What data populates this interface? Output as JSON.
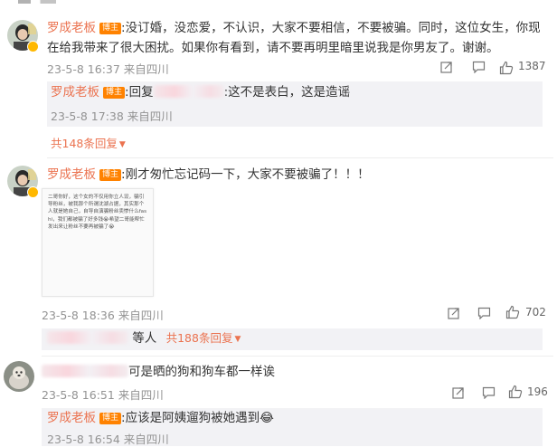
{
  "comments": [
    {
      "author": "罗成老板",
      "badge": "博主",
      "text": ":没订婚，没恋爱，不认识，大家不要相信，不要被骗。同时，这位女生，你现在给我带来了很大困扰。如果你有看到，请不要再明里暗里说我是你男友了。谢谢。",
      "time": "23-5-8 16:37 来自四川",
      "likes": "1387",
      "reply": {
        "author": "罗成老板",
        "badge": "博主",
        "prefix": ":回复",
        "text": ":这不是表白，这是造谣",
        "time": "23-5-8 17:38 来自四川"
      },
      "more_replies": "共148条回复"
    },
    {
      "author": "罗成老板",
      "badge": "博主",
      "text": ":刚才匆忙忘记码一下，大家不要被骗了！！！",
      "image_text": "二哥你好，这个女的不仅用你立人设，骗引导粉丝，被我那个所谓沈湖占据，其实那个人就是她自己，自导自演骗粉丝卖惨什么fashi，我们都被骗了好多钱😭希望二哥能帮忙发出来让粉丝不要再被骗了😭",
      "time": "23-5-8 18:36 来自四川",
      "likes": "702",
      "others_suffix": "等人",
      "more_replies": "共188条回复"
    },
    {
      "text": "可是晒的狗和狗车都一样诶",
      "time": "23-5-8 16:51 来自四川",
      "likes": "196",
      "reply": {
        "author": "罗成老板",
        "badge": "博主",
        "text": ":应该是阿姨遛狗被她遇到😂",
        "time": "23-5-8 16:54 来自四川"
      }
    }
  ],
  "icons": {
    "share": "share-icon",
    "comment": "comment-icon",
    "like": "thumbs-up-icon"
  },
  "colors": {
    "name": "#eb7350",
    "badge": "#ff8200",
    "meta": "#939393",
    "reply_bg": "#f2f2f5"
  }
}
